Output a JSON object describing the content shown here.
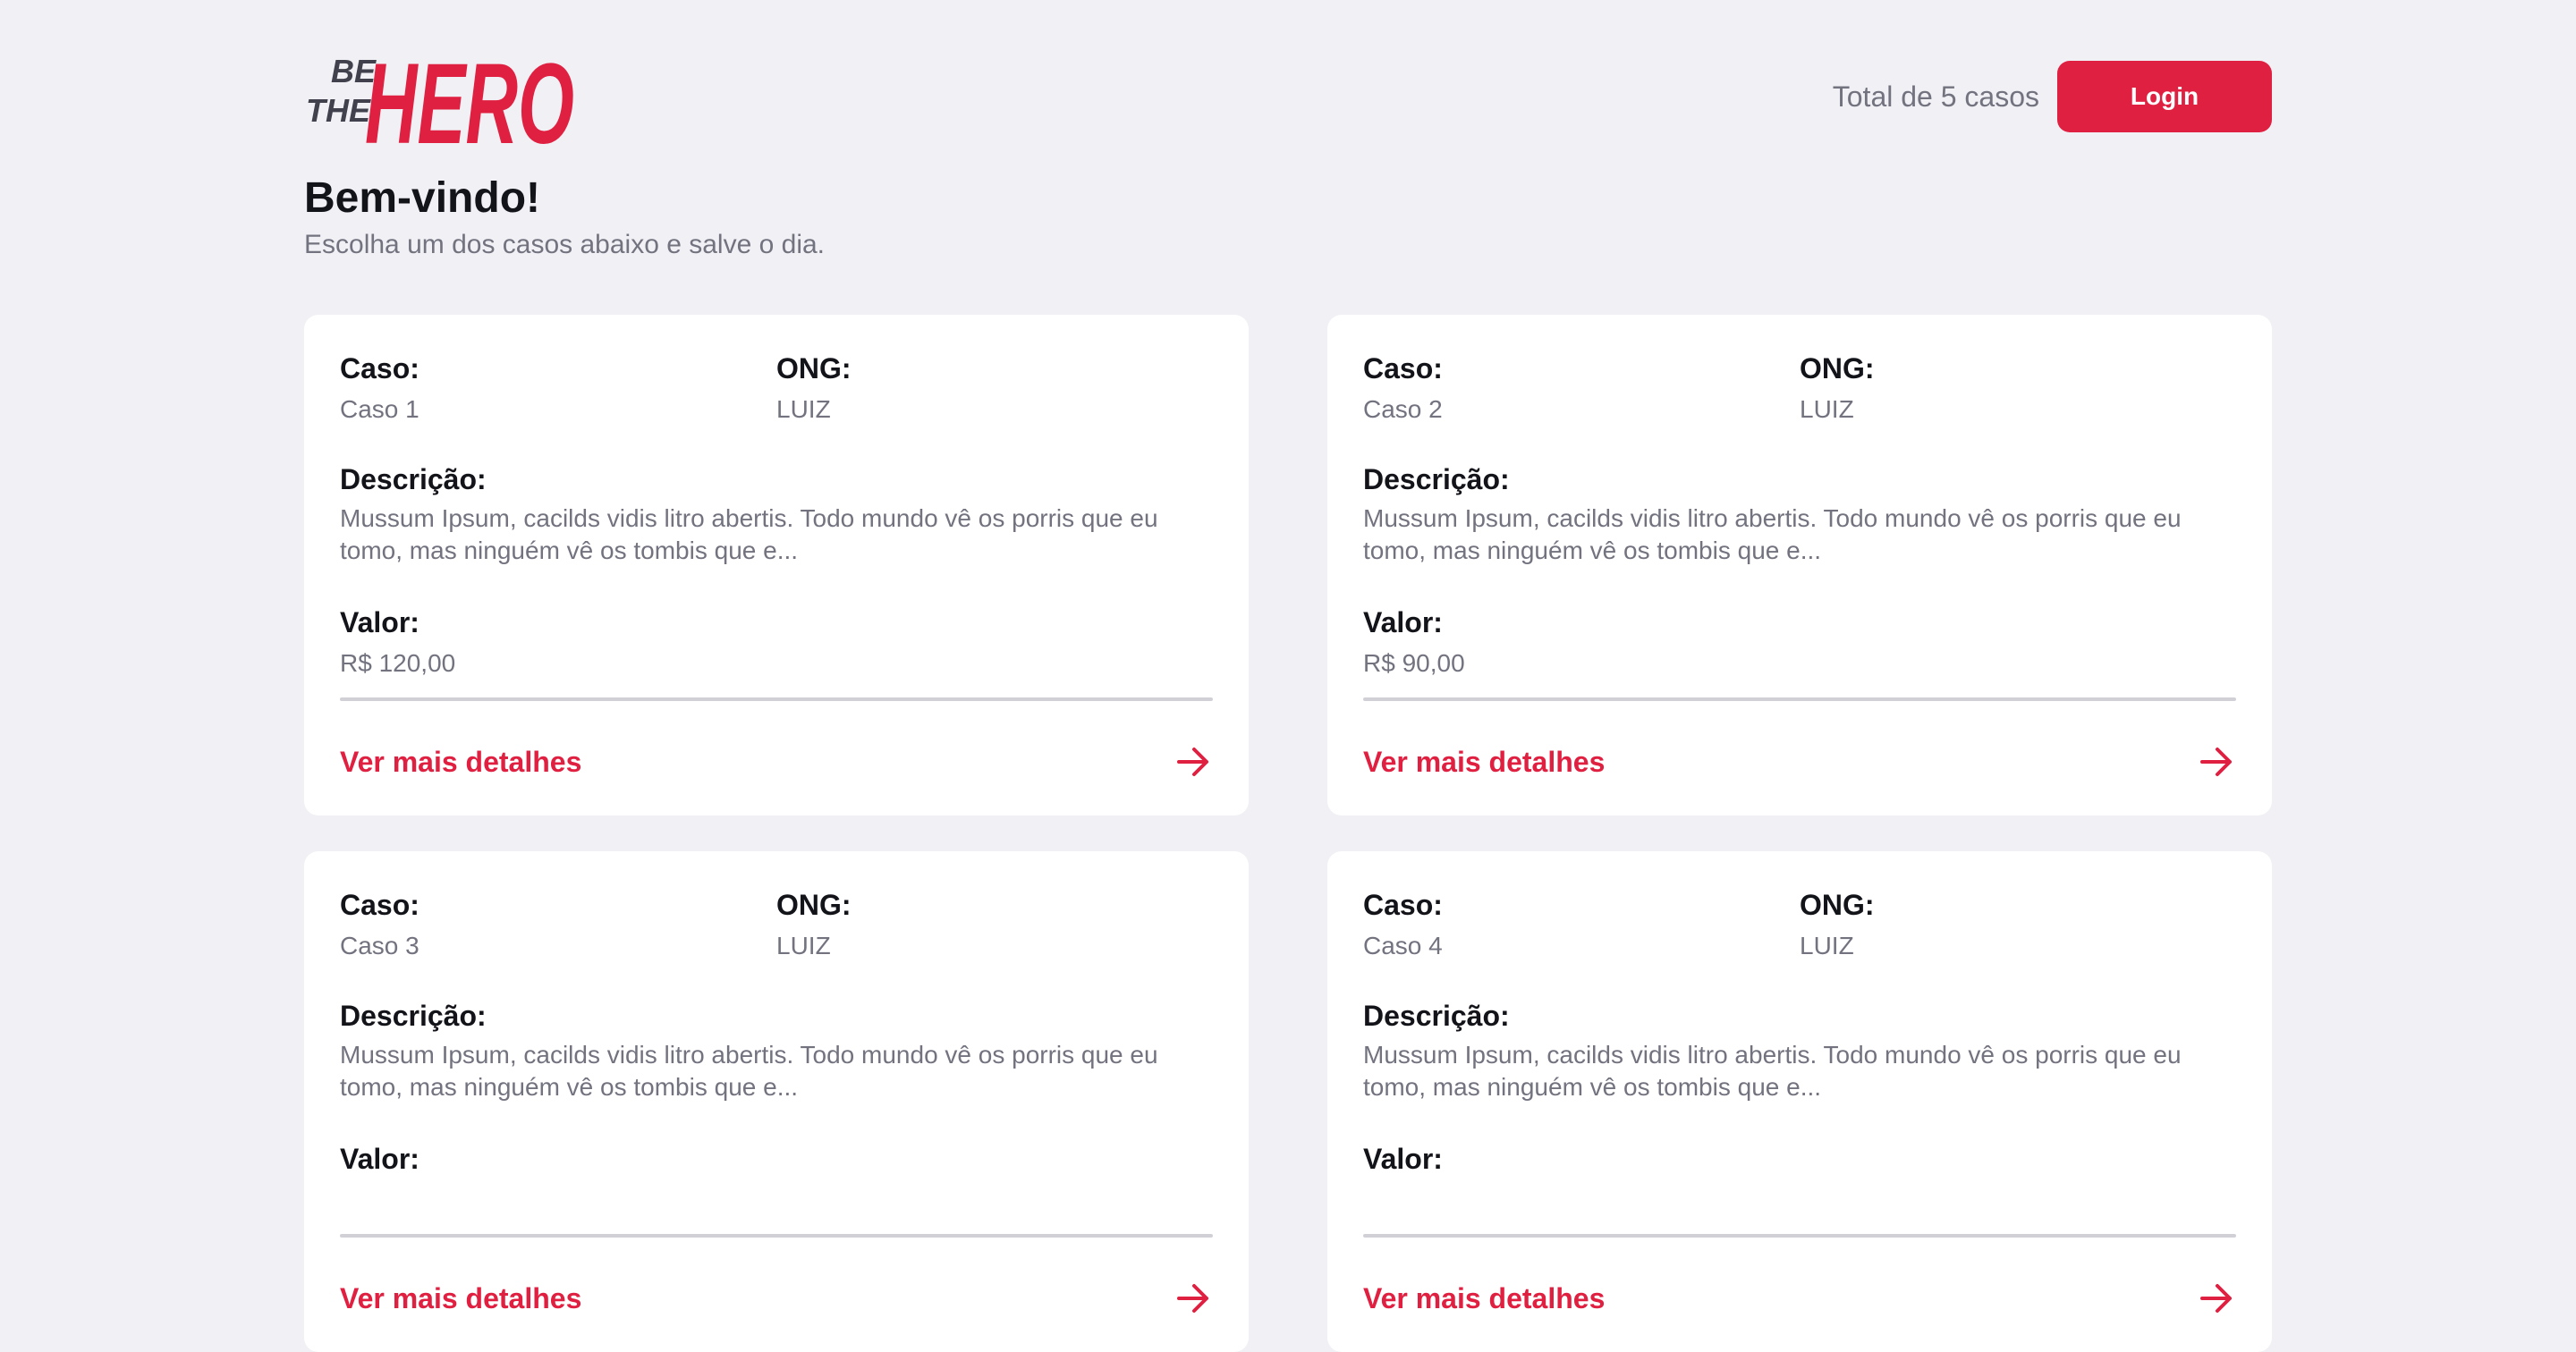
{
  "header": {
    "logo_text_small_1": "BE",
    "logo_text_small_2": "THE",
    "logo_text_big": "HERO",
    "total_cases": "Total de 5 casos",
    "login_label": "Login"
  },
  "welcome": {
    "title": "Bem-vindo!",
    "subtitle": "Escolha um dos casos abaixo e salve o dia."
  },
  "labels": {
    "case": "Caso:",
    "ong": "ONG:",
    "description": "Descrição:",
    "value": "Valor:",
    "details_link": "Ver mais detalhes"
  },
  "cases": [
    {
      "title": "Caso 1",
      "ong": "LUIZ",
      "description": "Mussum Ipsum, cacilds vidis litro abertis. Todo mundo vê os porris que eu tomo, mas ninguém vê os tombis que e...",
      "value": "R$ 120,00"
    },
    {
      "title": "Caso 2",
      "ong": "LUIZ",
      "description": "Mussum Ipsum, cacilds vidis litro abertis. Todo mundo vê os porris que eu tomo, mas ninguém vê os tombis que e...",
      "value": "R$ 90,00"
    },
    {
      "title": "Caso 3",
      "ong": "LUIZ",
      "description": "Mussum Ipsum, cacilds vidis litro abertis. Todo mundo vê os porris que eu tomo, mas ninguém vê os tombis que e...",
      "value": ""
    },
    {
      "title": "Caso 4",
      "ong": "LUIZ",
      "description": "Mussum Ipsum, cacilds vidis litro abertis. Todo mundo vê os porris que eu tomo, mas ninguém vê os tombis que e...",
      "value": ""
    }
  ],
  "colors": {
    "background": "#f0f0f5",
    "accent": "#e02041",
    "text_primary": "#13131a",
    "text_secondary": "#737380",
    "card": "#ffffff"
  },
  "icons": {
    "details": "arrow-right-icon"
  }
}
